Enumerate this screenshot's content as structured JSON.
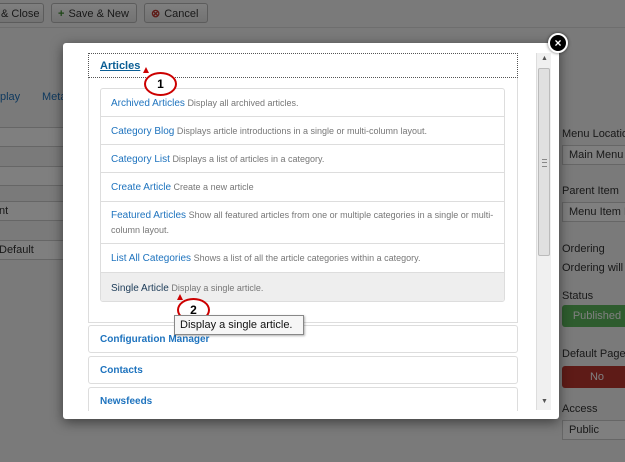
{
  "toolbar": {
    "save_close_label": "& Close",
    "save_new_label": "Save & New",
    "cancel_label": "Cancel"
  },
  "background": {
    "tab_1": "play",
    "tab_2": "Meta",
    "left_field_1": "nt",
    "left_field_2": "Default",
    "menu_location_label": "Menu Location",
    "menu_location_value": "Main Menu",
    "parent_item_label": "Parent Item",
    "parent_item_value": "Menu Item R",
    "ordering_label": "Ordering",
    "ordering_text": "Ordering will",
    "status_label": "Status",
    "status_value": "Published",
    "default_page_label": "Default Page",
    "default_page_value": "No",
    "access_label": "Access",
    "access_value": "Public"
  },
  "modal": {
    "close_symbol": "×",
    "open_section": "Articles",
    "items": [
      {
        "title": "Archived Articles",
        "desc": "Display all archived articles."
      },
      {
        "title": "Category Blog",
        "desc": "Displays article introductions in a single or multi-column layout."
      },
      {
        "title": "Category List",
        "desc": "Displays a list of articles in a category."
      },
      {
        "title": "Create Article",
        "desc": "Create a new article"
      },
      {
        "title": "Featured Articles",
        "desc": "Show all featured articles from one or multiple categories in a single or multi-column layout."
      },
      {
        "title": "List All Categories",
        "desc": "Shows a list of all the article categories within a category."
      },
      {
        "title": "Single Article",
        "desc": "Display a single article."
      }
    ],
    "sections": [
      "Configuration Manager",
      "Contacts",
      "Newsfeeds"
    ],
    "tooltip": "Display a single article."
  },
  "callouts": [
    "1",
    "2"
  ],
  "colors": {
    "link": "#1e73be",
    "published": "#5cb85c",
    "no": "#bd362f",
    "callout_border": "#cc0000"
  }
}
